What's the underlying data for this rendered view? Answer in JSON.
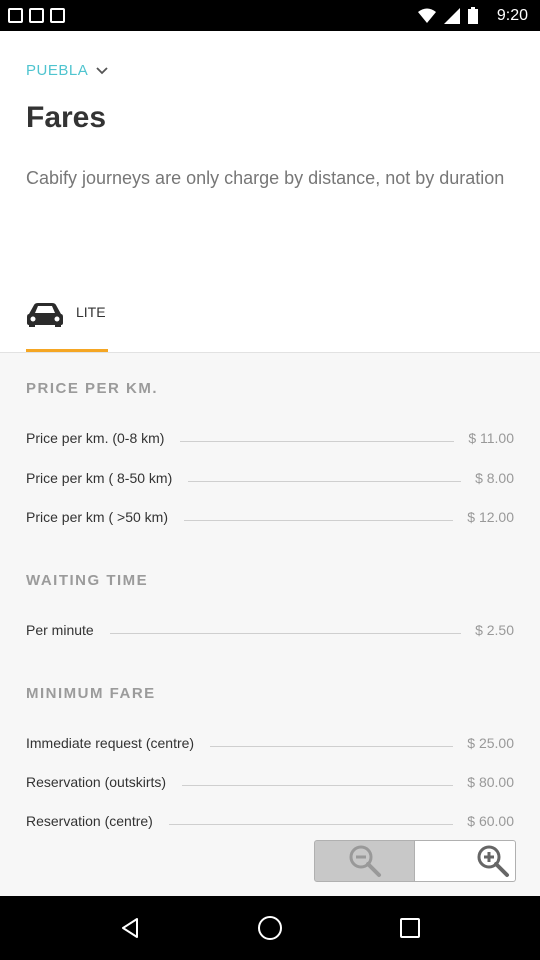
{
  "status_bar": {
    "time": "9:20"
  },
  "header": {
    "city": "PUEBLA",
    "title": "Fares",
    "subtitle": "Cabify journeys are only charge by distance, not by duration"
  },
  "tabs": [
    {
      "label": "LITE",
      "icon": "car-icon",
      "selected": true
    }
  ],
  "sections": {
    "price_per_km": {
      "heading": "PRICE PER KM.",
      "rows": [
        {
          "label": "Price per km. (0-8 km)",
          "value": "$ 11.00"
        },
        {
          "label": "Price per km ( 8-50 km)",
          "value": "$ 8.00"
        },
        {
          "label": "Price per km ( >50 km)",
          "value": "$ 12.00"
        }
      ]
    },
    "waiting_time": {
      "heading": "WAITING TIME",
      "rows": [
        {
          "label": "Per minute",
          "value": "$ 2.50"
        }
      ]
    },
    "minimum_fare": {
      "heading": "MINIMUM FARE",
      "rows": [
        {
          "label": "Immediate request (centre)",
          "value": "$ 25.00"
        },
        {
          "label": "Reservation (outskirts)",
          "value": "$ 80.00"
        },
        {
          "label": "Reservation (centre)",
          "value": "$ 60.00"
        }
      ]
    }
  },
  "zoom_controls": {
    "zoom_out_icon": "zoom-out-icon",
    "zoom_in_icon": "zoom-in-icon"
  },
  "colors": {
    "accent_teal": "#4fc4cf",
    "tab_underline": "#f5a623"
  }
}
